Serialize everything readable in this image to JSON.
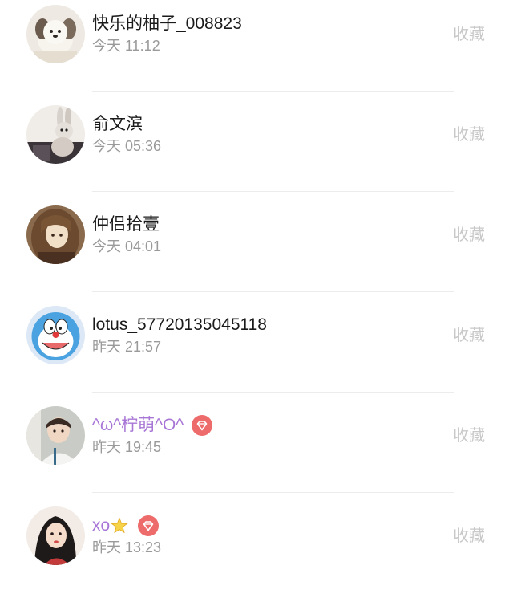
{
  "action_label": "收藏",
  "rows": [
    {
      "name": "快乐的柚子_008823",
      "time": "今天 11:12",
      "avatar": "avatar-puppy-image",
      "vip": false
    },
    {
      "name": "俞文滨",
      "time": "今天 05:36",
      "avatar": "avatar-rabbit-figure-image",
      "vip": false
    },
    {
      "name": "仲侣拾壹",
      "time": "今天 04:01",
      "avatar": "avatar-anime-girl-image",
      "vip": false
    },
    {
      "name": "lotus_57720135045118",
      "time": "昨天 21:57",
      "avatar": "avatar-doraemon-image",
      "vip": false
    },
    {
      "name": "^ω^柠萌^O^",
      "time": "昨天 19:45",
      "avatar": "avatar-boy-photo-image",
      "vip": true,
      "badge": "diamond-icon"
    },
    {
      "name": "xo",
      "time": "昨天 13:23",
      "avatar": "avatar-illustrated-woman-image",
      "vip": true,
      "extra_icon": "star-icon",
      "badge": "diamond-icon"
    }
  ],
  "colors": {
    "name": "#1a1a1a",
    "vip_name": "#a876d6",
    "time": "#9a9a9a",
    "action": "#c8c8c8",
    "badge": "#ee6b6b"
  }
}
